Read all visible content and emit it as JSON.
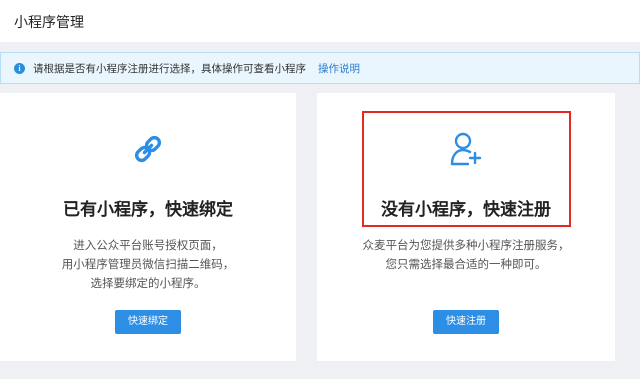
{
  "header": {
    "title": "小程序管理"
  },
  "notice": {
    "icon": "info-icon",
    "text": "请根据是否有小程序注册进行选择，具体操作可查看小程序",
    "link_label": "操作说明"
  },
  "cards": [
    {
      "icon": "link-icon",
      "title": "已有小程序，快速绑定",
      "desc_lines": [
        "进入公众平台账号授权页面，",
        "用小程序管理员微信扫描二维码，",
        "选择要绑定的小程序。"
      ],
      "button_label": "快速绑定"
    },
    {
      "icon": "add-user-icon",
      "title": "没有小程序，快速注册",
      "desc_lines": [
        "众麦平台为您提供多种小程序注册服务，",
        "您只需选择最合适的一种即可。"
      ],
      "button_label": "快速注册"
    }
  ],
  "colors": {
    "accent": "#2d8ee5",
    "highlight_border": "#e02a23",
    "notice_bg": "#eaf6fd"
  }
}
